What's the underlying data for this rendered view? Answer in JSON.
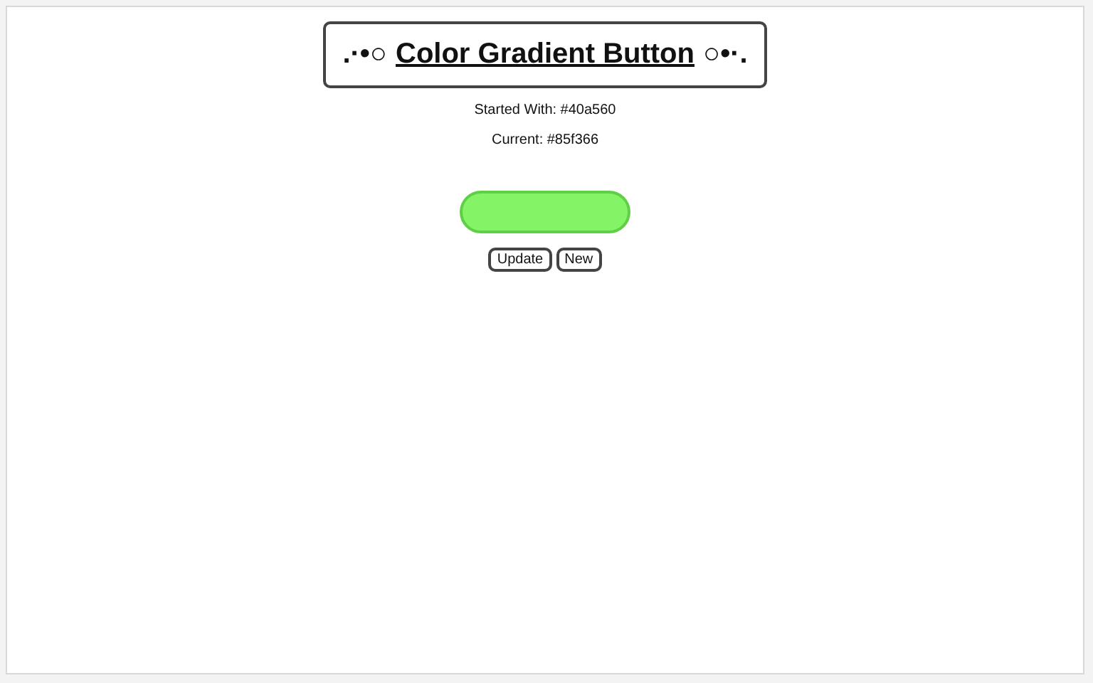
{
  "header": {
    "decor_left": ".·•○",
    "title": "Color Gradient Button",
    "decor_right": "○•·."
  },
  "started_with": "Started With: #40a560",
  "current": "Current: #85f366",
  "gradient_button": {
    "color": "#85f366"
  },
  "buttons": [
    "Update",
    "New"
  ]
}
